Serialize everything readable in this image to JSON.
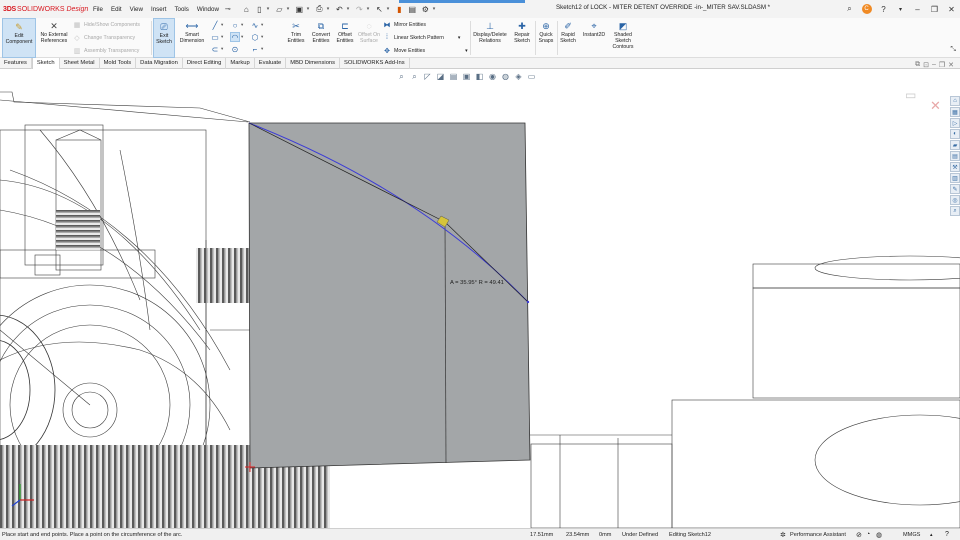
{
  "app": {
    "brand_ds": "3DS",
    "brand_sw": "SOLIDWORKS",
    "brand_design": "Design",
    "doc_title": "Sketch12 of LOCK - MITER DETENT OVERRIDE -in-_MITER SAV.SLDASM *"
  },
  "menu": [
    "File",
    "Edit",
    "View",
    "Insert",
    "Tools",
    "Window"
  ],
  "ribbon": {
    "edit_component": "Edit Component",
    "no_external_refs": "No External References",
    "hide_show_components": "Hide/Show Components",
    "change_transparency": "Change Transparency",
    "assembly_transparency": "Assembly Transparency",
    "exit_sketch": "Exit Sketch",
    "smart_dimension": "Smart Dimension",
    "trim_entities": "Trim Entities",
    "convert_entities": "Convert Entities",
    "offset_entities": "Offset Entities",
    "offset_on_surface": "Offset On Surface",
    "mirror_entities": "Mirror Entities",
    "linear_sketch_pattern": "Linear Sketch Pattern",
    "move_entities": "Move Entities",
    "display_delete_relations": "Display/Delete Relations",
    "repair_sketch": "Repair Sketch",
    "quick_snaps": "Quick Snaps",
    "rapid_sketch": "Rapid Sketch",
    "instant2d": "Instant2D",
    "shaded_sketch_contours": "Shaded Sketch Contours"
  },
  "tabs": [
    "Features",
    "Sketch",
    "Sheet Metal",
    "Mold Tools",
    "Data Migration",
    "Direct Editing",
    "Markup",
    "Evaluate",
    "MBD Dimensions",
    "SOLIDWORKS Add-Ins"
  ],
  "active_tab": "Sketch",
  "canvas": {
    "arc_annotation": "A = 35.95° R = 49.41"
  },
  "status": {
    "hint": "Place start and end points.  Place a point on the circumference of the arc.",
    "x_coord": "17.51mm",
    "y_coord": "23.54mm",
    "z_coord": "0mm",
    "definition": "Under Defined",
    "editing": "Editing Sketch12",
    "perf_assistant": "Performance Assistant",
    "units": "MMGS"
  },
  "colors": {
    "brand": "#d8171f",
    "face_fill": "#a3a6a8",
    "arc": "#3b3bd6",
    "accent": "#2a64a6"
  },
  "icons": [
    "home-icon",
    "new-icon",
    "open-icon",
    "save-icon",
    "print-icon",
    "undo-icon",
    "redo-icon",
    "select-icon",
    "rebuild-icon",
    "file-props-icon",
    "options-icon",
    "search-icon",
    "help-icon",
    "user-icon",
    "minimize-icon",
    "restore-icon",
    "close-icon"
  ]
}
